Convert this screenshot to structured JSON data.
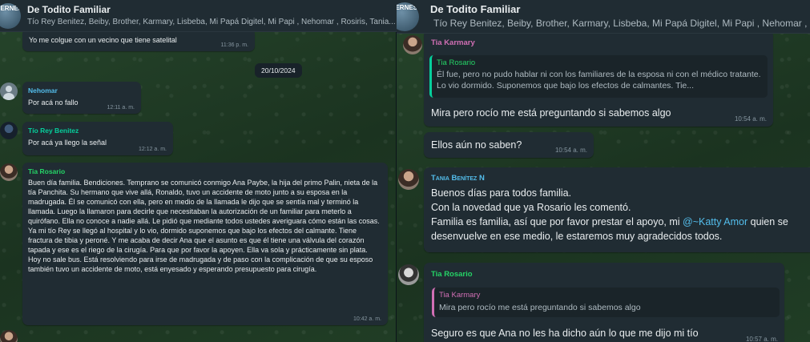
{
  "left": {
    "header": {
      "title": "De Todito Familiar",
      "members": "Tío Rey Benitez, Beiby, Brother, Karmary, Lisbeba, Mi Papá Digitel, Mi Papi , Nehomar , Rosiris, Tania...",
      "avatar_text": "JERNES"
    },
    "messages": [
      {
        "sender": "",
        "text": "Yo me colgue con un vecino que tiene satelital",
        "time": "11:36 p. m."
      },
      {
        "sender": "Nehomar",
        "text": "Por acá no fallo",
        "time": "12:11 a. m."
      },
      {
        "sender": "Tío Rey Benitez",
        "text": "Por acá ya llego la señal",
        "time": "12:12 a. m."
      },
      {
        "sender": "Tia Rosario",
        "text": "Buen día familia. Bendiciones. Temprano se comunicó conmigo Ana Paybe, la hija del primo Palin, nieta de la tía Panchita. Su hermano que vive allá, Ronaldo, tuvo un accidente de moto junto a su esposa en la madrugada. Él se comunicó con ella, pero en medio de la llamada le dijo que se sentía mal y terminó la llamada. Luego la llamaron para decirle que necesitaban la autorización de un familiar para meterlo a quirófano. Ella no conoce a nadie allá. Le pidió que mediante todos ustedes averiguara cómo están las cosas. Ya mi tío Rey se llegó al hospital y lo vio, dormido suponemos que bajo los efectos del calmante. Tiene fractura de tibia y peroné. Y me acaba de decir Ana que el asunto es que él tiene una válvula del corazón tapada y ese es el riego de la cirugía. Para que por favor la apoyen. Ella va sola y prácticamente sin plata. Hoy no sale bus. Está resolviendo para irse de madrugada y de paso con la complicación de que su esposo también tuvo un accidente de moto, está enyesado y esperando presupuesto para cirugía.",
        "time": "10:42 a. m."
      }
    ],
    "date_chip": "20/10/2024"
  },
  "right": {
    "header": {
      "title": "De Todito Familiar",
      "members": "Tío Rey Benitez, Beiby, Brother, Karmary, Lisbeba, Mi Papá Digitel, Mi Papi , Nehomar , Rosiris, Tania...",
      "avatar_text": "JERNES"
    },
    "msg1": {
      "sender": "Tia Karmary",
      "quote_author": "Tia Rosario",
      "quote_text": "Él fue, pero no pudo hablar ni con los familiares de la esposa ni con el médico tratante. Lo vio dormido. Suponemos que bajo los efectos de calmantes. Tie...",
      "text": "Mira pero rocío me está preguntando si sabemos algo",
      "time": "10:54 a. m."
    },
    "msg2": {
      "text": "Ellos aún no saben?",
      "time": "10:54 a. m."
    },
    "msg3": {
      "sender": "Tania Benítez N",
      "line1": "Buenos días para todos familia.",
      "line2": "Con la novedad que ya Rosario les comentó.",
      "line3_pre": "Familia es familia, así que por favor prestar el apoyo, mi ",
      "mention": "@~Katty Amor",
      "line3_post": " quien se",
      "line4": "desenvuelve en ese medio, le estaremos muy agradecidos todos."
    },
    "msg4": {
      "sender": "Tia Rosario",
      "quote_author": "Tia Karmary",
      "quote_text": "Mira pero rocío me está preguntando si sabemos algo",
      "text": "Seguro es que Ana no les ha dicho aún lo que me dijo mi tío",
      "time": "10:57 a. m."
    }
  },
  "colors": {
    "bubble": "#202c33",
    "header": "#202c33",
    "wallpaper": "#1f3a24",
    "sender_nehomar": "#53bdeb",
    "sender_rey": "#06cf9c",
    "sender_rosario": "#25d366",
    "sender_karmary": "#d16fb5",
    "sender_tania": "#53bdeb",
    "mention": "#53bdeb"
  }
}
